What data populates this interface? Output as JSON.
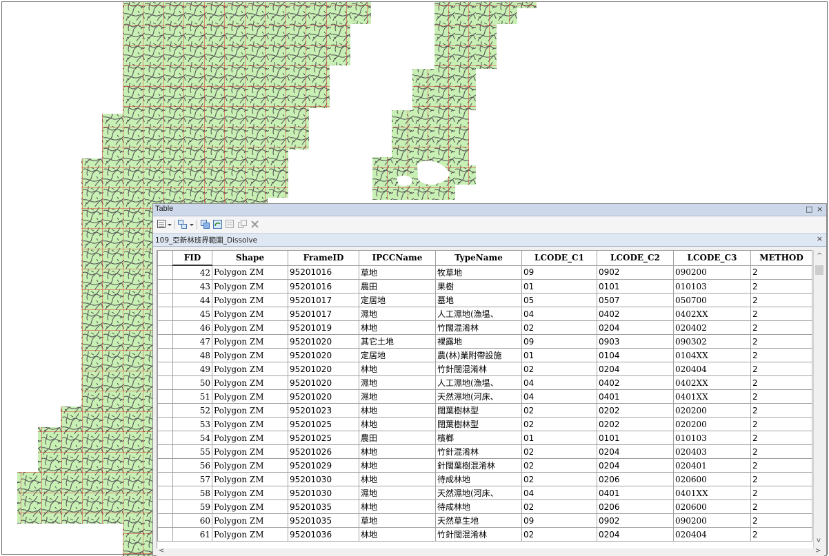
{
  "window": {
    "title": "Table",
    "restore_glyph": "□",
    "close_glyph": "×"
  },
  "toolbar": {
    "icons": [
      "table-options-icon",
      "related-tables-icon",
      "select-by-attributes-icon",
      "switch-selection-icon",
      "clear-selection-icon",
      "zoom-to-selected-icon",
      "delete-selected-icon"
    ]
  },
  "tab": {
    "label": "109_亞新林班界範圍_Dissolve",
    "close_glyph": "×"
  },
  "table": {
    "columns": [
      "FID",
      "Shape",
      "FrameID",
      "IPCCName",
      "TypeName",
      "LCODE_C1",
      "LCODE_C2",
      "LCODE_C3",
      "METHOD"
    ],
    "rows": [
      [
        "42",
        "Polygon ZM",
        "95201016",
        "草地",
        "牧草地",
        "09",
        "0902",
        "090200",
        "2"
      ],
      [
        "43",
        "Polygon ZM",
        "95201016",
        "農田",
        "果樹",
        "01",
        "0101",
        "010103",
        "2"
      ],
      [
        "44",
        "Polygon ZM",
        "95201017",
        "定居地",
        "墓地",
        "05",
        "0507",
        "050700",
        "2"
      ],
      [
        "45",
        "Polygon ZM",
        "95201017",
        "濕地",
        "人工濕地(漁塭、",
        "04",
        "0402",
        "0402XX",
        "2"
      ],
      [
        "46",
        "Polygon ZM",
        "95201019",
        "林地",
        "竹闊混淆林",
        "02",
        "0204",
        "020402",
        "2"
      ],
      [
        "47",
        "Polygon ZM",
        "95201020",
        "其它土地",
        "裸露地",
        "09",
        "0903",
        "090302",
        "2"
      ],
      [
        "48",
        "Polygon ZM",
        "95201020",
        "定居地",
        "農(林)業附帶設施",
        "01",
        "0104",
        "0104XX",
        "2"
      ],
      [
        "49",
        "Polygon ZM",
        "95201020",
        "林地",
        "竹針闊混淆林",
        "02",
        "0204",
        "020404",
        "2"
      ],
      [
        "50",
        "Polygon ZM",
        "95201020",
        "濕地",
        "人工濕地(漁塭、",
        "04",
        "0402",
        "0402XX",
        "2"
      ],
      [
        "51",
        "Polygon ZM",
        "95201020",
        "濕地",
        "天然濕地(河床、",
        "04",
        "0401",
        "0401XX",
        "2"
      ],
      [
        "52",
        "Polygon ZM",
        "95201023",
        "林地",
        "闊葉樹林型",
        "02",
        "0202",
        "020200",
        "2"
      ],
      [
        "53",
        "Polygon ZM",
        "95201025",
        "林地",
        "闊葉樹林型",
        "02",
        "0202",
        "020200",
        "2"
      ],
      [
        "54",
        "Polygon ZM",
        "95201025",
        "農田",
        "檳榔",
        "01",
        "0101",
        "010103",
        "2"
      ],
      [
        "55",
        "Polygon ZM",
        "95201026",
        "林地",
        "竹針混淆林",
        "02",
        "0204",
        "020403",
        "2"
      ],
      [
        "56",
        "Polygon ZM",
        "95201029",
        "林地",
        "針闊葉樹混淆林",
        "02",
        "0204",
        "020401",
        "2"
      ],
      [
        "57",
        "Polygon ZM",
        "95201030",
        "林地",
        "待成林地",
        "02",
        "0206",
        "020600",
        "2"
      ],
      [
        "58",
        "Polygon ZM",
        "95201030",
        "濕地",
        "天然濕地(河床、",
        "04",
        "0401",
        "0401XX",
        "2"
      ],
      [
        "59",
        "Polygon ZM",
        "95201035",
        "林地",
        "待成林地",
        "02",
        "0206",
        "020600",
        "2"
      ],
      [
        "60",
        "Polygon ZM",
        "95201035",
        "草地",
        "天然草生地",
        "09",
        "0902",
        "090200",
        "2"
      ],
      [
        "61",
        "Polygon ZM",
        "95201036",
        "林地",
        "竹針闊混淆林",
        "02",
        "0204",
        "020404",
        "2"
      ]
    ]
  },
  "scrollbars": {
    "up": "^",
    "down": "v",
    "left": "<",
    "right": ">"
  },
  "colors": {
    "polygon_fill": "#c8f0b4",
    "frame_stroke": "#e03030",
    "line_work": "#555555"
  }
}
